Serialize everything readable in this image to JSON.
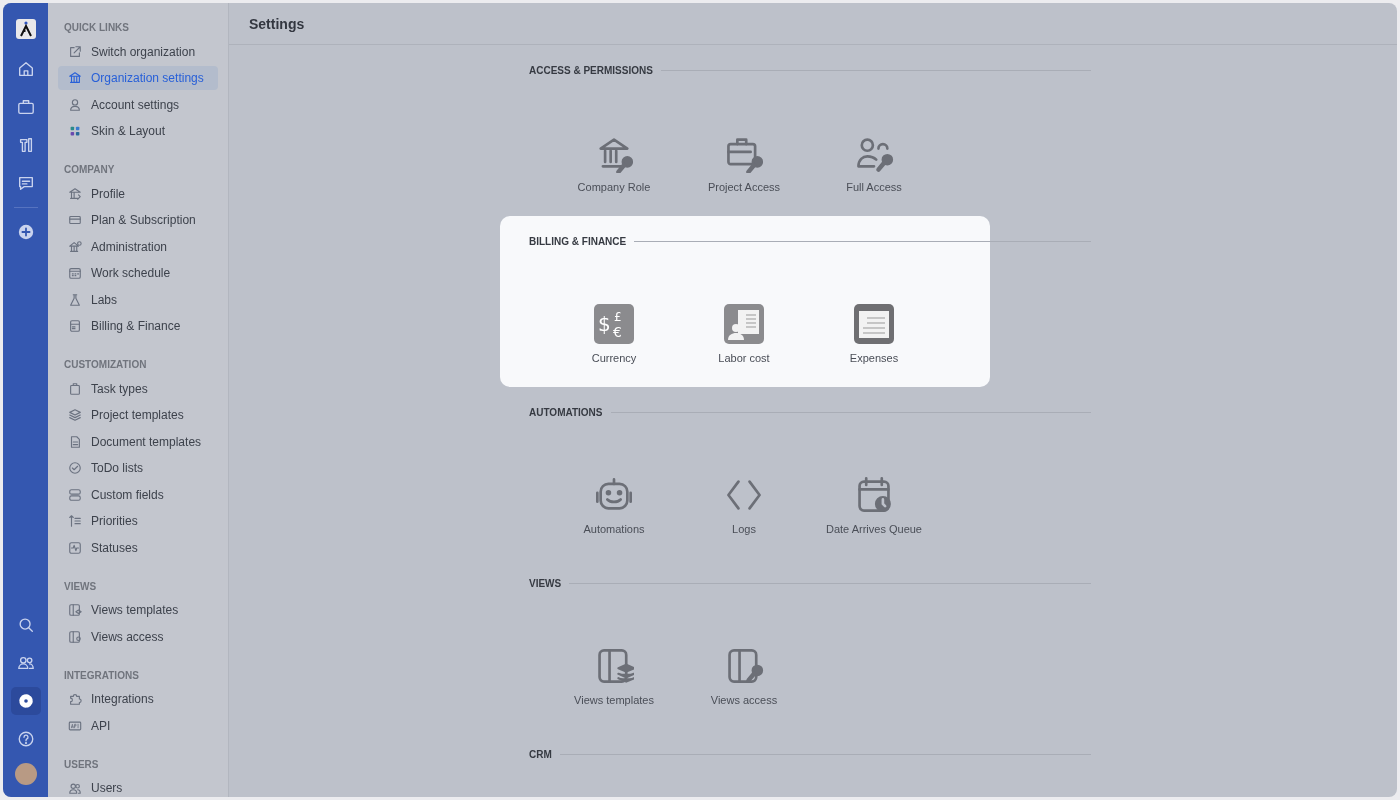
{
  "rail": {
    "top": [
      {
        "selected": false
      },
      {
        "selected": false
      },
      {
        "selected": false
      },
      {
        "selected": false
      },
      {
        "selected": false
      }
    ],
    "bottom": [
      {
        "selected": false
      },
      {
        "selected": false
      },
      {
        "selected": true
      },
      {
        "selected": false
      }
    ]
  },
  "sidebar": [
    {
      "heading": "QUICK LINKS",
      "items": [
        {
          "label": "Switch organization",
          "selected": false
        },
        {
          "label": "Organization settings",
          "selected": true
        },
        {
          "label": "Account settings",
          "selected": false
        },
        {
          "label": "Skin & Layout",
          "selected": false
        }
      ]
    },
    {
      "heading": "COMPANY",
      "items": [
        {
          "label": "Profile",
          "selected": false
        },
        {
          "label": "Plan & Subscription",
          "selected": false
        },
        {
          "label": "Administration",
          "selected": false
        },
        {
          "label": "Work schedule",
          "selected": false
        },
        {
          "label": "Labs",
          "selected": false
        },
        {
          "label": "Billing & Finance",
          "selected": false
        }
      ]
    },
    {
      "heading": "CUSTOMIZATION",
      "items": [
        {
          "label": "Task types",
          "selected": false
        },
        {
          "label": "Project templates",
          "selected": false
        },
        {
          "label": "Document templates",
          "selected": false
        },
        {
          "label": "ToDo lists",
          "selected": false
        },
        {
          "label": "Custom fields",
          "selected": false
        },
        {
          "label": "Priorities",
          "selected": false
        },
        {
          "label": "Statuses",
          "selected": false
        }
      ]
    },
    {
      "heading": "VIEWS",
      "items": [
        {
          "label": "Views templates",
          "selected": false
        },
        {
          "label": "Views access",
          "selected": false
        }
      ]
    },
    {
      "heading": "INTEGRATIONS",
      "items": [
        {
          "label": "Integrations",
          "selected": false
        },
        {
          "label": "API",
          "selected": false
        }
      ]
    },
    {
      "heading": "USERS",
      "items": [
        {
          "label": "Users",
          "selected": false
        }
      ]
    }
  ],
  "page_title": "Settings",
  "sections": [
    {
      "heading": "ACCESS & PERMISSIONS",
      "highlighted": false,
      "items": [
        {
          "label": "Company Role"
        },
        {
          "label": "Project Access"
        },
        {
          "label": "Full Access"
        }
      ]
    },
    {
      "heading": "BILLING & FINANCE",
      "highlighted": true,
      "items": [
        {
          "label": "Currency",
          "symbols": [
            "$",
            "£",
            "€"
          ]
        },
        {
          "label": "Labor cost"
        },
        {
          "label": "Expenses"
        }
      ]
    },
    {
      "heading": "AUTOMATIONS",
      "highlighted": false,
      "items": [
        {
          "label": "Automations"
        },
        {
          "label": "Logs"
        },
        {
          "label": "Date Arrives Queue"
        }
      ]
    },
    {
      "heading": "VIEWS",
      "highlighted": false,
      "items": [
        {
          "label": "Views templates"
        },
        {
          "label": "Views access"
        }
      ]
    },
    {
      "heading": "CRM",
      "highlighted": false
    }
  ]
}
